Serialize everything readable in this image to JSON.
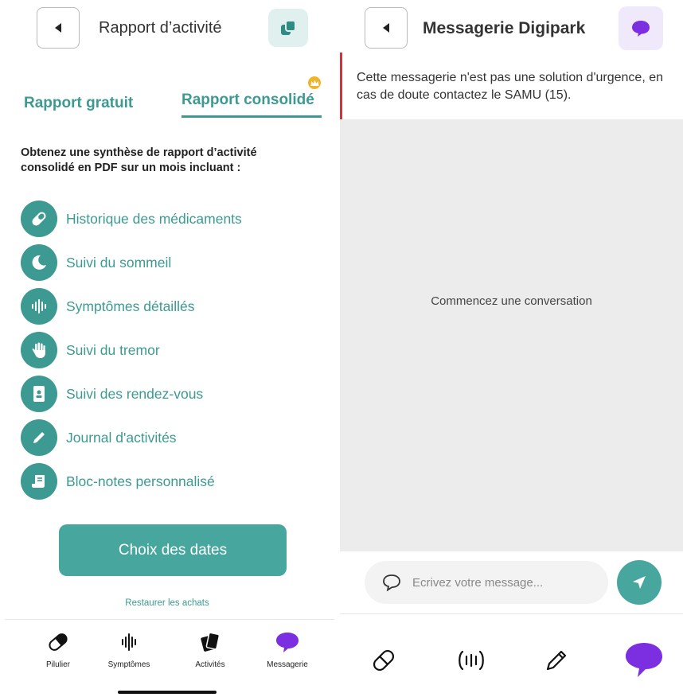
{
  "left": {
    "header": {
      "title": "Rapport d’activité",
      "back_icon": "back-arrow-icon",
      "action_icon": "copy-icon"
    },
    "tabs": [
      {
        "label": "Rapport gratuit",
        "active": false
      },
      {
        "label": "Rapport consolidé",
        "active": true,
        "badge_icon": "crown-icon"
      }
    ],
    "intro": "Obtenez une synthèse de rapport d’activité consolidé en PDF sur un mois incluant :",
    "features": [
      {
        "label": "Historique des médicaments",
        "icon": "pill-icon"
      },
      {
        "label": "Suivi du sommeil",
        "icon": "moon-icon"
      },
      {
        "label": "Symptômes détaillés",
        "icon": "soundwave-icon"
      },
      {
        "label": "Suivi du tremor",
        "icon": "hand-icon"
      },
      {
        "label": "Suivi des rendez-vous",
        "icon": "badge-icon"
      },
      {
        "label": "Journal d'activités",
        "icon": "pencil-icon"
      },
      {
        "label": "Bloc-notes personnalisé",
        "icon": "notepad-icon"
      }
    ],
    "cta_label": "Choix des dates",
    "restore_label": "Restaurer les achats",
    "nav": [
      {
        "label": "Pilulier",
        "icon": "pill-icon"
      },
      {
        "label": "Symptômes",
        "icon": "soundwave-icon"
      },
      {
        "label": "Activités",
        "icon": "cards-icon"
      },
      {
        "label": "Messagerie",
        "icon": "chat-bubble-icon"
      }
    ]
  },
  "right": {
    "header": {
      "title": "Messagerie Digipark",
      "back_icon": "back-arrow-icon",
      "action_icon": "chat-bubble-icon"
    },
    "banner": "Cette messagerie n'est pas une solution d'urgence, en cas de doute contactez le SAMU (15).",
    "empty_state": "Commencez une conversation",
    "composer": {
      "placeholder": "Ecrivez votre message...",
      "value": ""
    },
    "nav_icons": [
      "pill-icon",
      "soundwave-icon",
      "pencil-icon",
      "chat-bubble-icon"
    ]
  },
  "colors": {
    "teal": "#47a79f",
    "teal_text": "#3c9a92",
    "purple": "#7b2fe0",
    "urgent_red": "#d0353a",
    "chat_bg": "#ececec"
  }
}
